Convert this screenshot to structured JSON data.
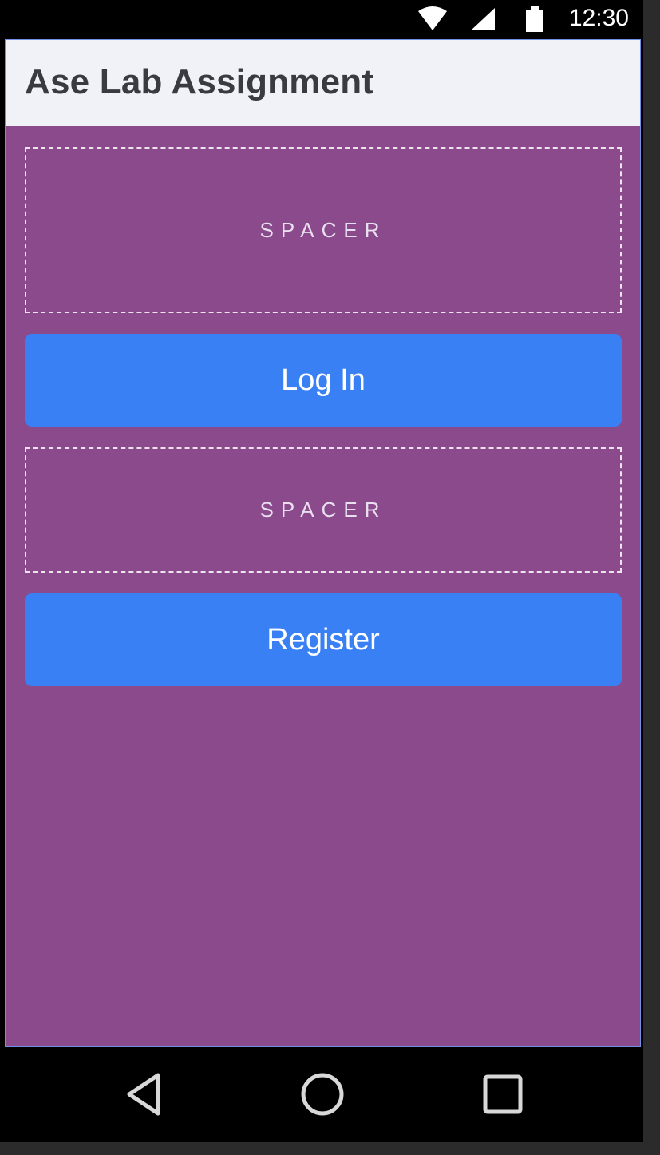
{
  "status_bar": {
    "time": "12:30",
    "icons": [
      "wifi-icon",
      "cell-signal-icon",
      "battery-icon"
    ]
  },
  "app_bar": {
    "title": "Ase Lab Assignment"
  },
  "main": {
    "spacer_top_label": "SPACER",
    "login_button_label": "Log In",
    "spacer_middle_label": "SPACER",
    "register_button_label": "Register"
  },
  "nav_bar": {
    "icons": [
      "back-icon",
      "home-icon",
      "recents-icon"
    ]
  },
  "colors": {
    "screen_background": "#8a4a8b",
    "app_bar_background": "#f1f2f7",
    "button_background": "#3a80f5",
    "button_text": "#ffffff"
  }
}
